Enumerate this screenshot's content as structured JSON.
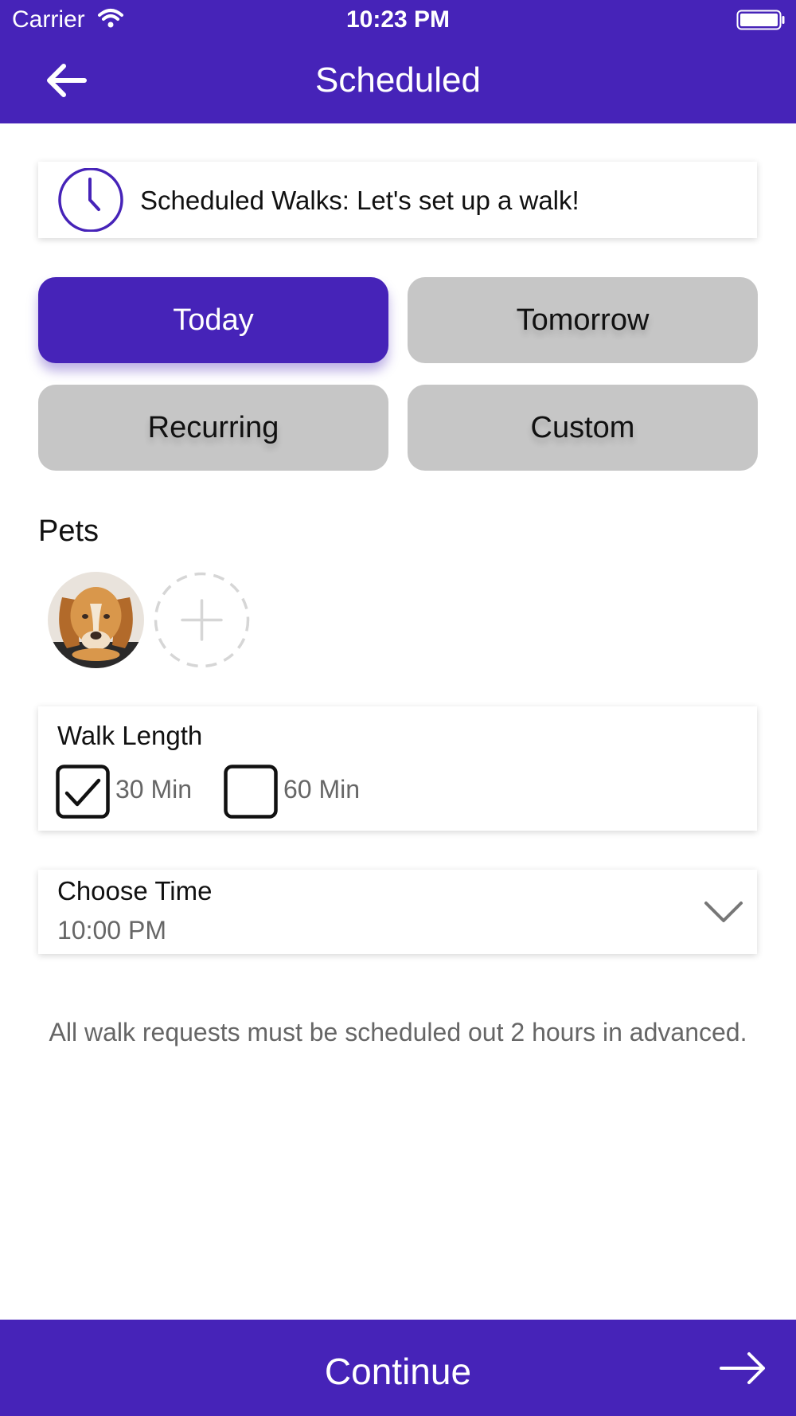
{
  "status": {
    "carrier": "Carrier",
    "time": "10:23 PM"
  },
  "header": {
    "title": "Scheduled",
    "back_icon": "back-arrow-icon"
  },
  "info": {
    "text": "Scheduled Walks: Let's set up a walk!",
    "icon": "clock-icon"
  },
  "schedule_options": [
    {
      "label": "Today",
      "selected": true
    },
    {
      "label": "Tomorrow",
      "selected": false
    },
    {
      "label": "Recurring",
      "selected": false
    },
    {
      "label": "Custom",
      "selected": false
    }
  ],
  "pets": {
    "title": "Pets"
  },
  "walk_length": {
    "title": "Walk Length",
    "options": [
      {
        "label": "30 Min",
        "checked": true
      },
      {
        "label": "60 Min",
        "checked": false
      }
    ]
  },
  "choose_time": {
    "title": "Choose Time",
    "value": "10:00 PM"
  },
  "notice": "All walk requests must be scheduled out 2 hours in advanced.",
  "footer": {
    "continue_label": "Continue"
  },
  "colors": {
    "primary": "#4623b8",
    "inactive_button": "#c6c6c6",
    "secondary_text": "#666666"
  }
}
